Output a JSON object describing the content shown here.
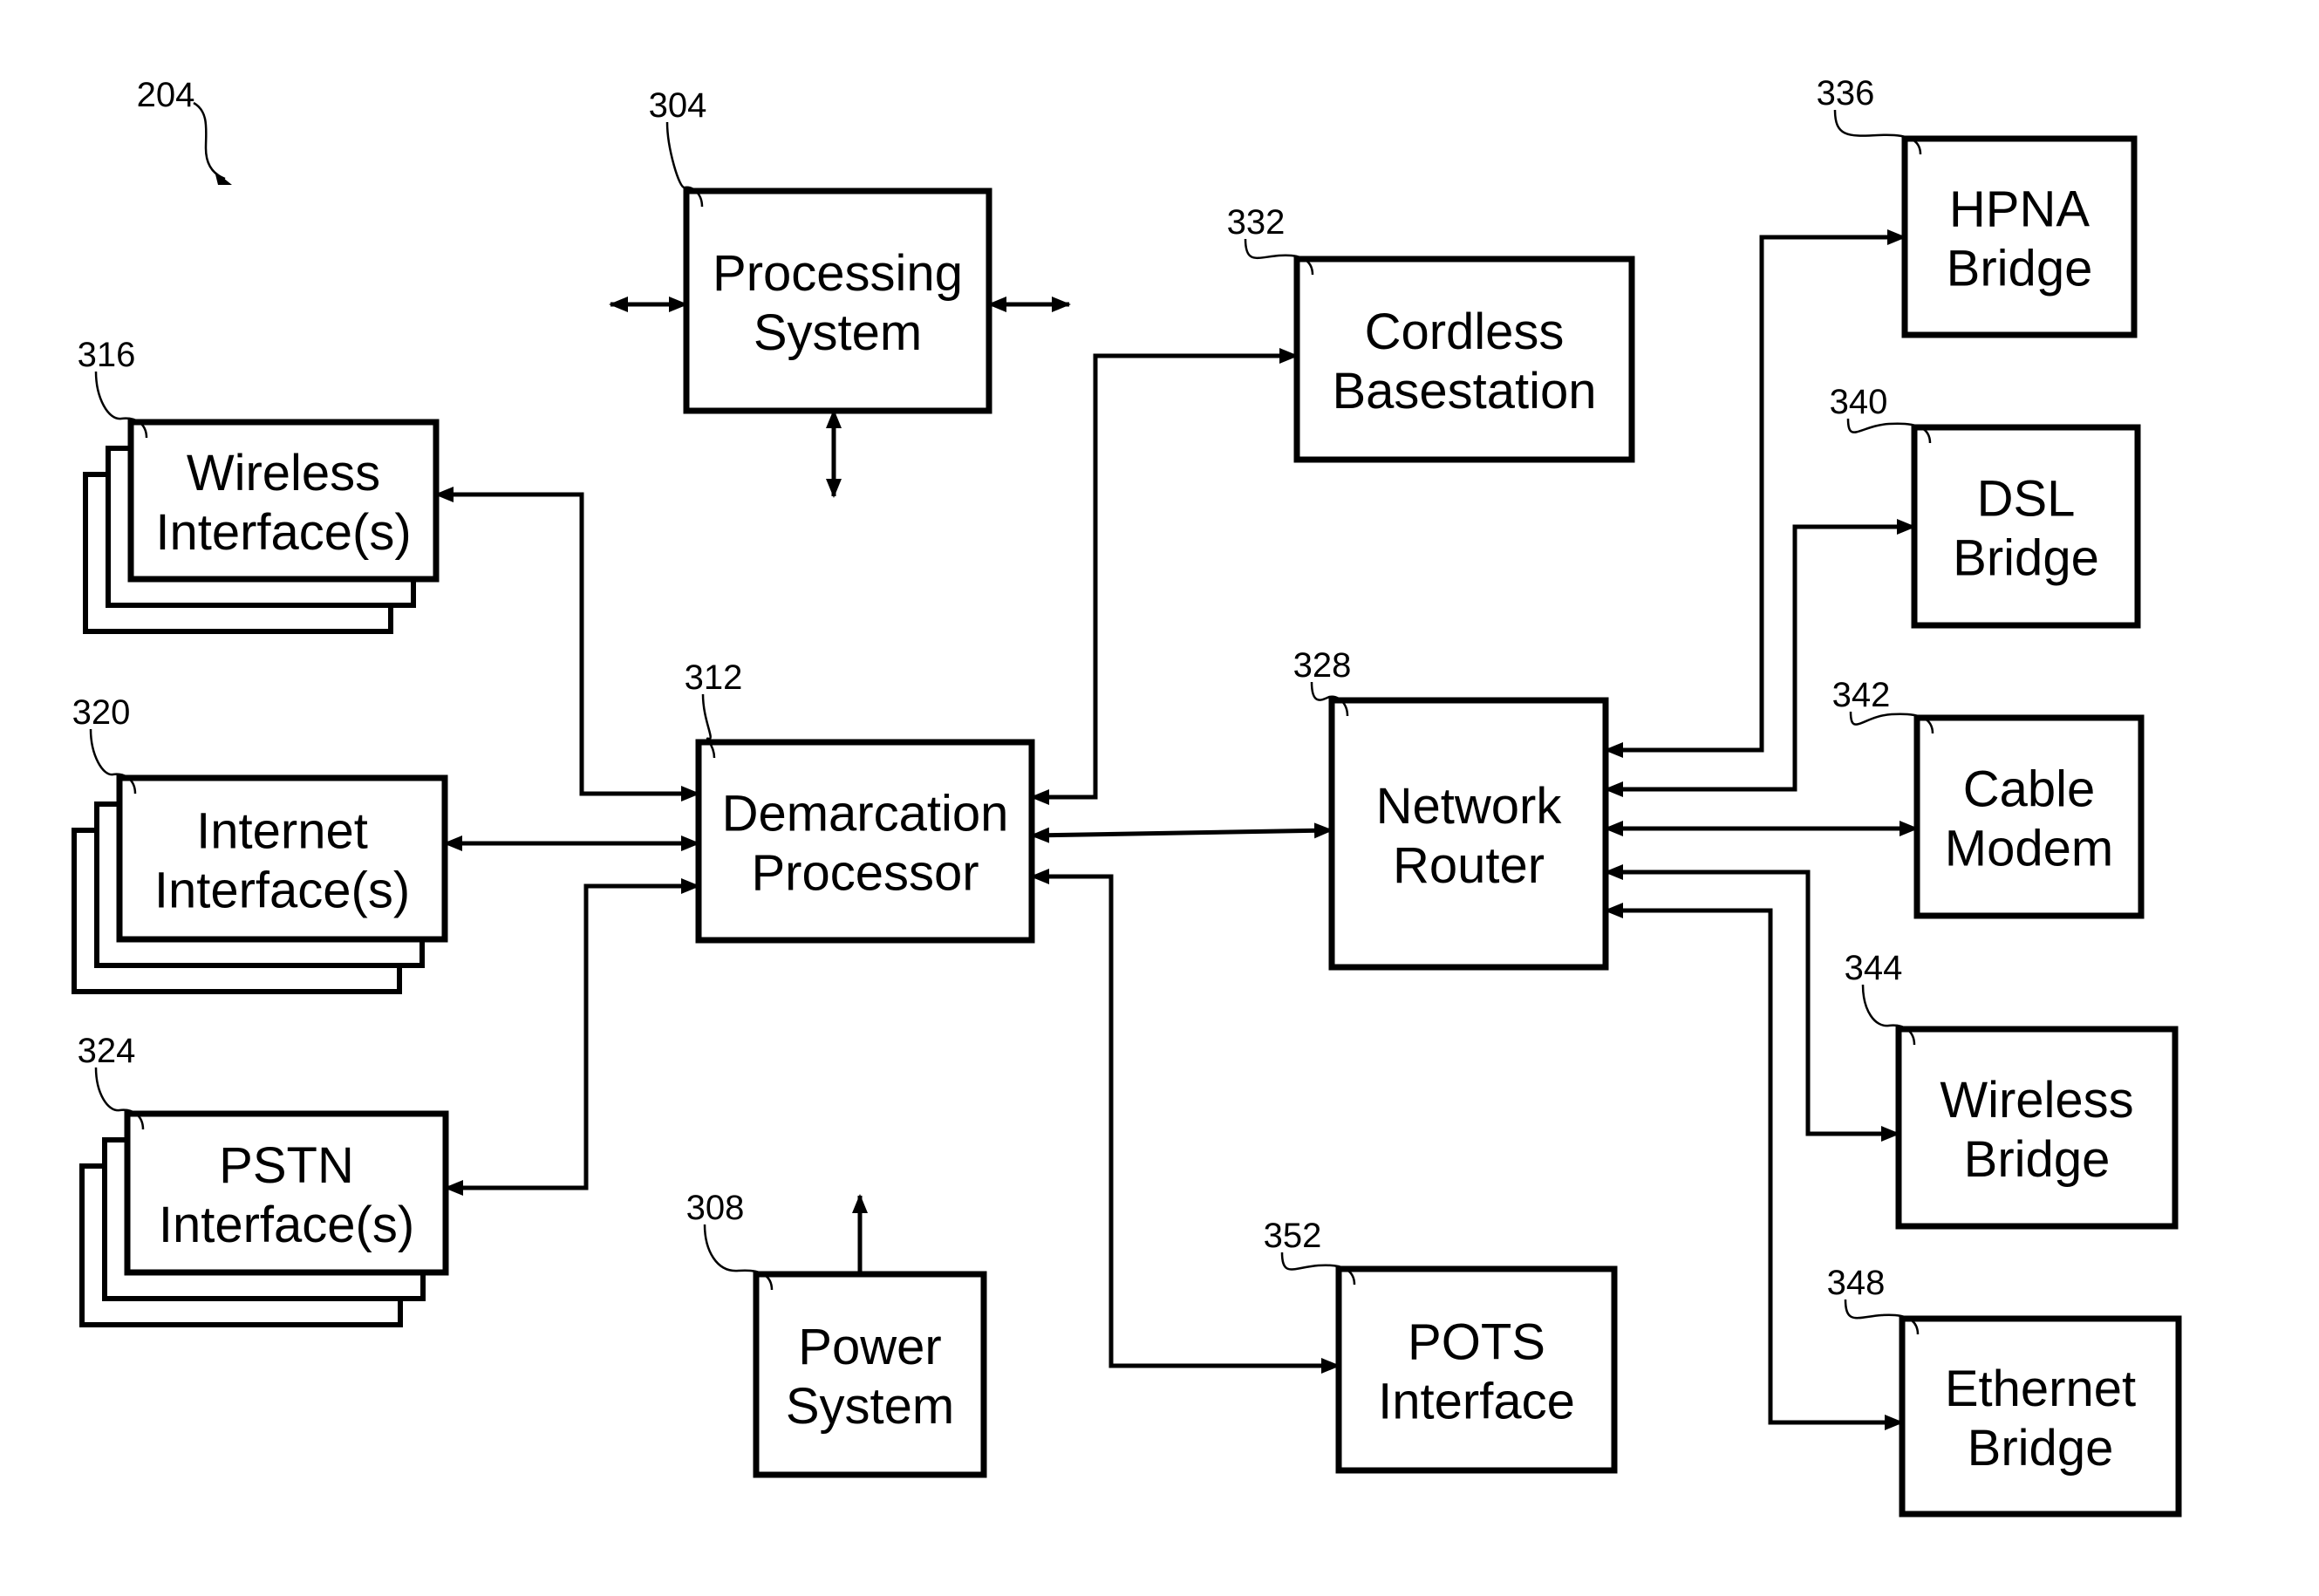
{
  "figure": {
    "reference": "204"
  },
  "blocks": {
    "processing_system": {
      "ref": "304",
      "lines": [
        "Processing",
        "System"
      ]
    },
    "power_system": {
      "ref": "308",
      "lines": [
        "Power",
        "System"
      ]
    },
    "demarcation_processor": {
      "ref": "312",
      "lines": [
        "Demarcation",
        "Processor"
      ]
    },
    "wireless_interfaces": {
      "ref": "316",
      "lines": [
        "Wireless",
        "Interface(s)"
      ]
    },
    "internet_interfaces": {
      "ref": "320",
      "lines": [
        "Internet",
        "Interface(s)"
      ]
    },
    "pstn_interfaces": {
      "ref": "324",
      "lines": [
        "PSTN",
        "Interface(s)"
      ]
    },
    "network_router": {
      "ref": "328",
      "lines": [
        "Network",
        "Router"
      ]
    },
    "cordless_basestation": {
      "ref": "332",
      "lines": [
        "Cordless",
        "Basestation"
      ]
    },
    "hpna_bridge": {
      "ref": "336",
      "lines": [
        "HPNA",
        "Bridge"
      ]
    },
    "dsl_bridge": {
      "ref": "340",
      "lines": [
        "DSL",
        "Bridge"
      ]
    },
    "cable_modem": {
      "ref": "342",
      "lines": [
        "Cable",
        "Modem"
      ]
    },
    "wireless_bridge": {
      "ref": "344",
      "lines": [
        "Wireless",
        "Bridge"
      ]
    },
    "ethernet_bridge": {
      "ref": "348",
      "lines": [
        "Ethernet",
        "Bridge"
      ]
    },
    "pots_interface": {
      "ref": "352",
      "lines": [
        "POTS",
        "Interface"
      ]
    }
  },
  "connections": [
    {
      "from": "demarcation_processor",
      "to": "wireless_interfaces",
      "direction": "bidirectional"
    },
    {
      "from": "demarcation_processor",
      "to": "internet_interfaces",
      "direction": "bidirectional"
    },
    {
      "from": "demarcation_processor",
      "to": "pstn_interfaces",
      "direction": "bidirectional"
    },
    {
      "from": "demarcation_processor",
      "to": "cordless_basestation",
      "direction": "bidirectional"
    },
    {
      "from": "demarcation_processor",
      "to": "network_router",
      "direction": "bidirectional"
    },
    {
      "from": "demarcation_processor",
      "to": "pots_interface",
      "direction": "bidirectional"
    },
    {
      "from": "network_router",
      "to": "hpna_bridge",
      "direction": "bidirectional"
    },
    {
      "from": "network_router",
      "to": "dsl_bridge",
      "direction": "bidirectional"
    },
    {
      "from": "network_router",
      "to": "cable_modem",
      "direction": "bidirectional"
    },
    {
      "from": "network_router",
      "to": "wireless_bridge",
      "direction": "bidirectional"
    },
    {
      "from": "network_router",
      "to": "ethernet_bridge",
      "direction": "bidirectional"
    },
    {
      "from": "processing_system",
      "to": "left",
      "direction": "bidirectional"
    },
    {
      "from": "processing_system",
      "to": "right",
      "direction": "bidirectional"
    },
    {
      "from": "processing_system",
      "to": "down",
      "direction": "bidirectional"
    },
    {
      "from": "power_system",
      "to": "up",
      "direction": "outgoing"
    }
  ]
}
